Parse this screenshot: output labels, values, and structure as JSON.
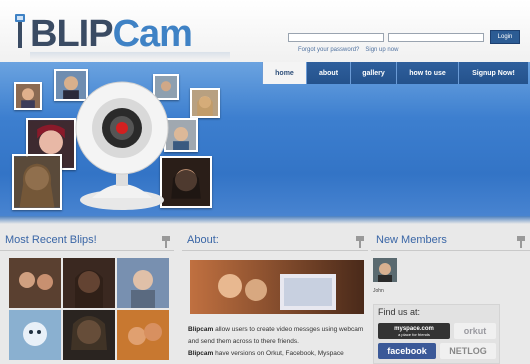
{
  "brand": {
    "name_part1": "BLIP",
    "name_part2": "Cam"
  },
  "login": {
    "username_placeholder": "",
    "password_placeholder": "",
    "button_label": "Login",
    "forgot_label": "Forgot your password?",
    "signup_label": "Sign up now"
  },
  "nav": {
    "tabs": [
      {
        "label": "home",
        "active": true
      },
      {
        "label": "about",
        "active": false
      },
      {
        "label": "gallery",
        "active": false
      },
      {
        "label": "how to use",
        "active": false
      },
      {
        "label": "Signup Now!",
        "active": false
      }
    ]
  },
  "sections": {
    "recent_blips": {
      "title": "Most Recent Blips!"
    },
    "about": {
      "title": "About:",
      "paragraph1_brand": "Blipcam",
      "paragraph1_text": " allow users to create video messges using webcam and send them across to there friends.",
      "paragraph2_brand": "Blipcam",
      "paragraph2_text": " have versions on Orkut, Facebook, Myspace"
    },
    "new_members": {
      "title": "New Members",
      "members": [
        {
          "name": "John"
        }
      ]
    },
    "find_us": {
      "title": "Find us at:",
      "networks": [
        "myspace.com",
        "a place for friends",
        "orkut",
        "facebook",
        "NETLOG"
      ]
    }
  },
  "colors": {
    "accent_blue": "#3a66a6",
    "banner_blue": "#3d7fcf",
    "nav_dark": "#24528c",
    "login_button": "#2c5c94"
  }
}
